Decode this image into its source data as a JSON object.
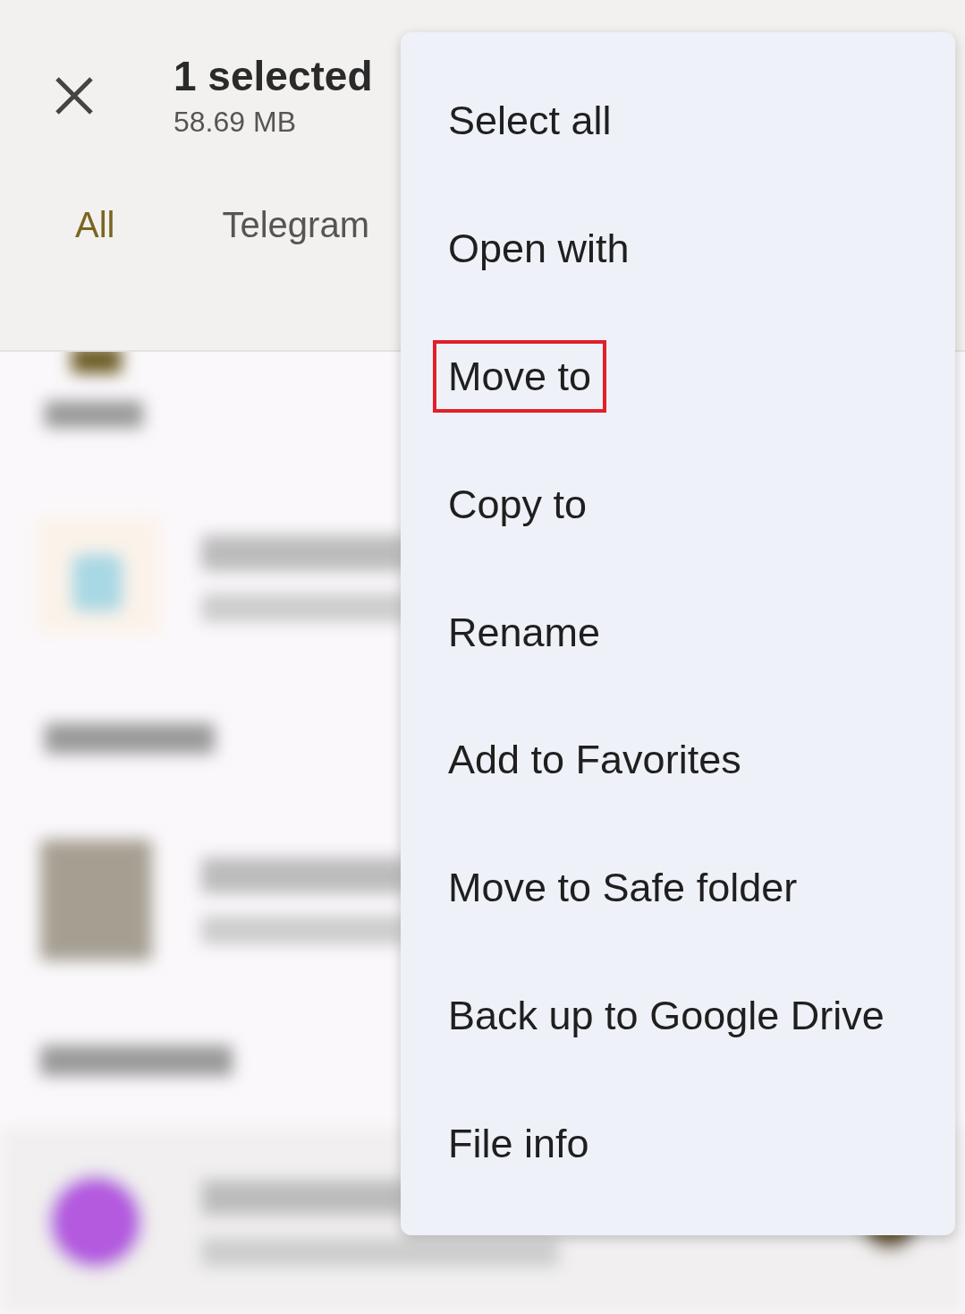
{
  "header": {
    "title": "1 selected",
    "subtitle": "58.69 MB"
  },
  "tabs": [
    {
      "label": "All",
      "selected": true
    },
    {
      "label": "Telegram",
      "selected": false
    }
  ],
  "menu": {
    "items": [
      {
        "label": "Select all",
        "highlighted": false
      },
      {
        "label": "Open with",
        "highlighted": false
      },
      {
        "label": "Move to",
        "highlighted": true
      },
      {
        "label": "Copy to",
        "highlighted": false
      },
      {
        "label": "Rename",
        "highlighted": false
      },
      {
        "label": "Add to Favorites",
        "highlighted": false
      },
      {
        "label": "Move to Safe folder",
        "highlighted": false
      },
      {
        "label": "Back up to Google Drive",
        "highlighted": false
      },
      {
        "label": "File info",
        "highlighted": false
      }
    ]
  }
}
